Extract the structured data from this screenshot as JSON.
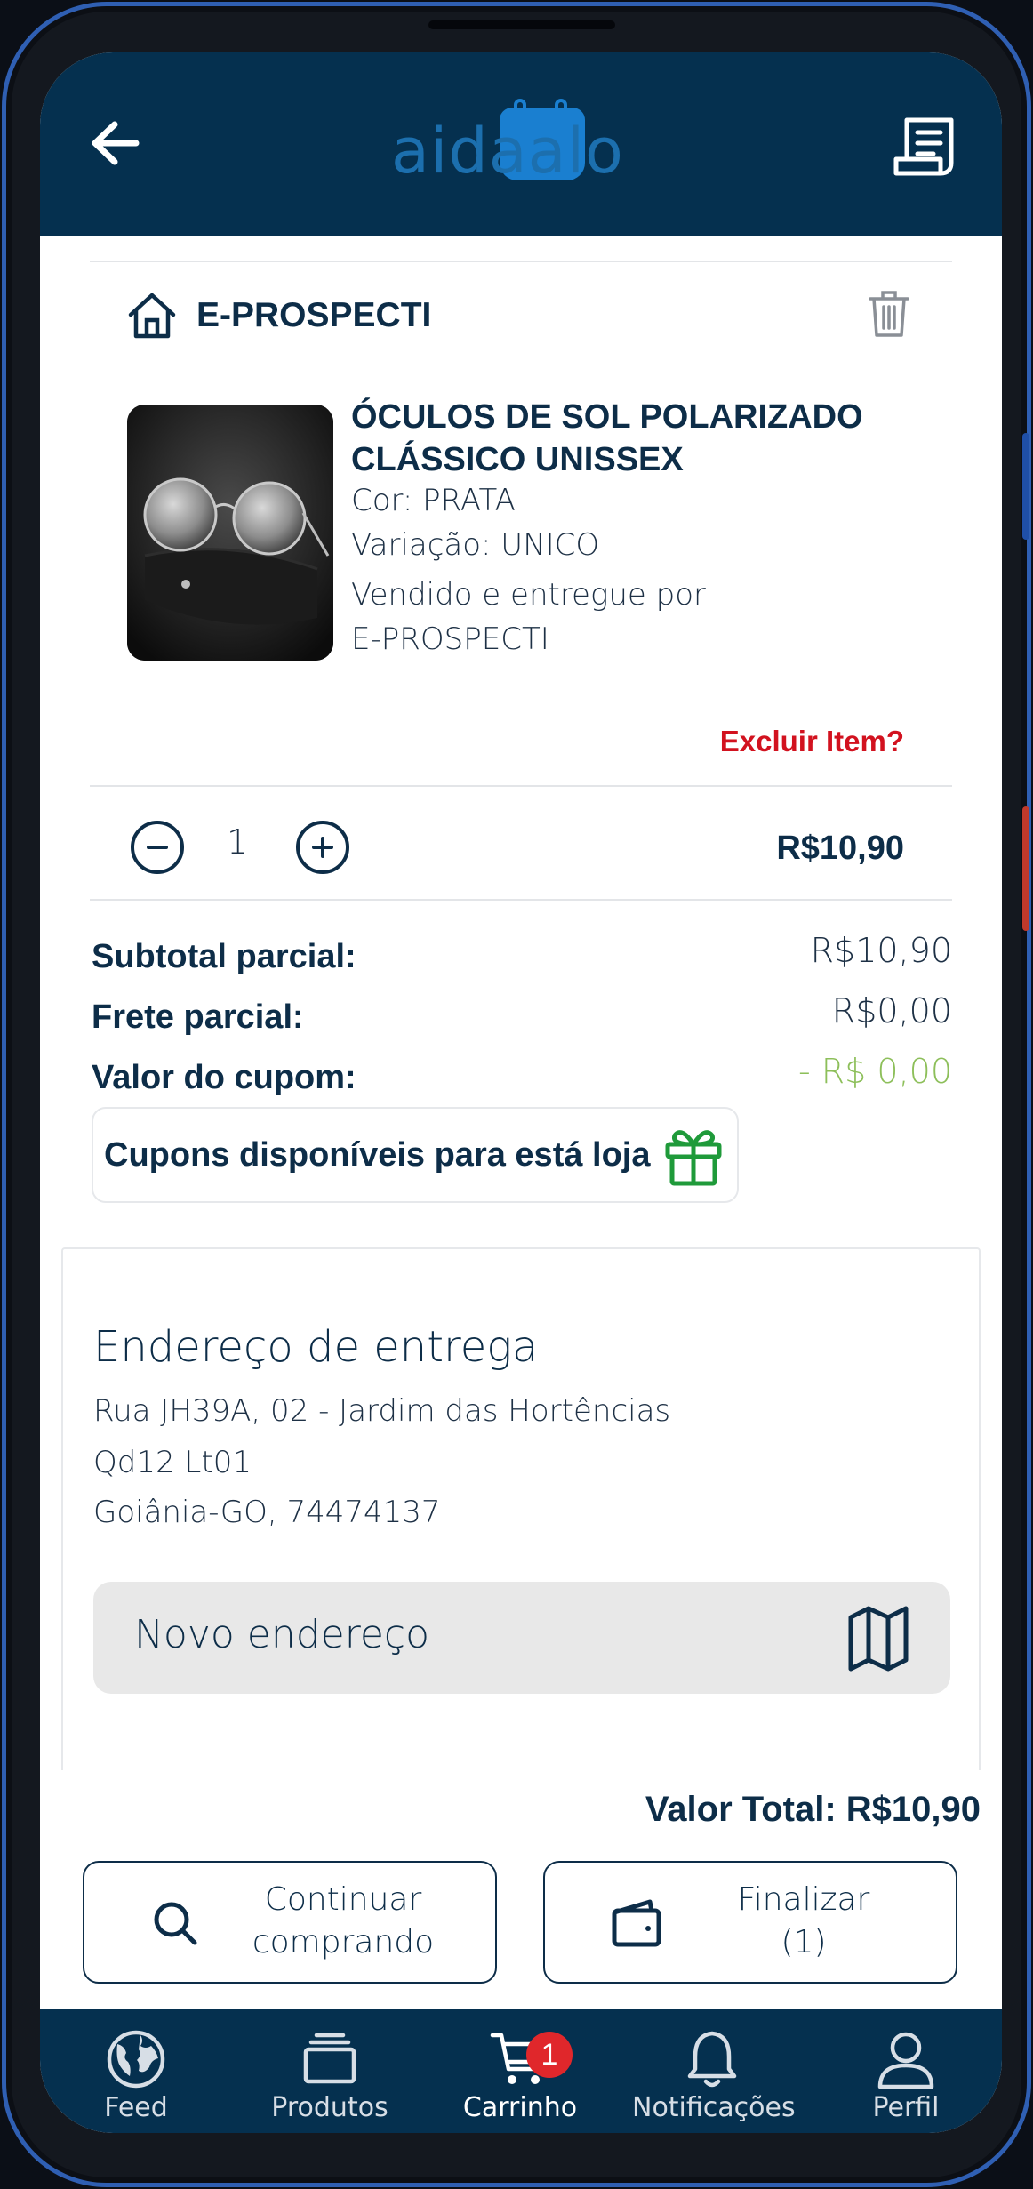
{
  "header": {
    "logo_text": "aidaalo"
  },
  "store": {
    "name": "E-PROSPECTI"
  },
  "product": {
    "title": "ÓCULOS DE SOL POLARIZADO CLÁSSICO UNISSEX",
    "color_line": "Cor: PRATA",
    "variation_line": "Variação: UNICO",
    "seller_line1": "Vendido e entregue por",
    "seller_line2": "E-PROSPECTI",
    "delete_link": "Excluir Item?",
    "quantity": "1",
    "price": "R$10,90"
  },
  "summary": {
    "subtotal_label": "Subtotal parcial:",
    "subtotal_value": "R$10,90",
    "freight_label": "Frete parcial:",
    "freight_value": "R$0,00",
    "coupon_label": "Valor do cupom:",
    "coupon_value": "- R$ 0,00",
    "coupons_button": "Cupons disponíveis para está loja"
  },
  "address": {
    "title": "Endereço de entrega",
    "line1": "Rua JH39A, 02 - Jardim das Hortências",
    "line2": "Qd12 Lt01",
    "line3": "Goiânia-GO, 74474137",
    "new_address_button": "Novo endereço"
  },
  "footer": {
    "total": "Valor Total: R$10,90",
    "continue_line1": "Continuar",
    "continue_line2": "comprando",
    "finish_line1": "Finalizar",
    "finish_line2": "(1)"
  },
  "tabs": [
    {
      "label": "Feed",
      "icon": "globe-icon"
    },
    {
      "label": "Produtos",
      "icon": "stack-icon"
    },
    {
      "label": "Carrinho",
      "icon": "cart-icon",
      "badge": "1",
      "active": true
    },
    {
      "label": "Notificações",
      "icon": "bell-icon"
    },
    {
      "label": "Perfil",
      "icon": "user-icon"
    }
  ],
  "colors": {
    "primary": "#05304f",
    "danger": "#d2121f",
    "coupon_green": "#8dbf5a",
    "gift_green": "#1f9a3a",
    "badge": "#e0272b"
  }
}
